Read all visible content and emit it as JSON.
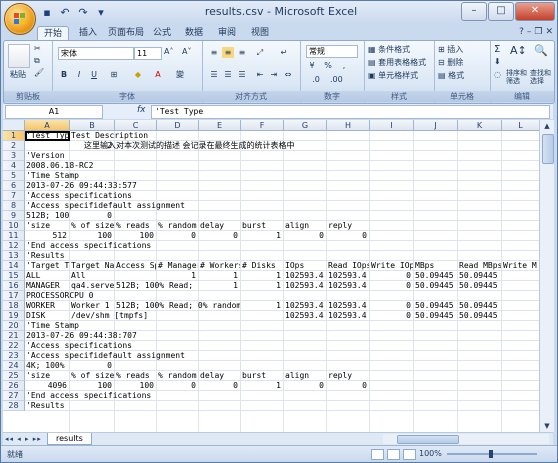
{
  "window": {
    "title": "results.csv - Microsoft Excel"
  },
  "qat_icons": [
    "save-icon",
    "undo-icon",
    "redo-icon",
    "dropdown-icon"
  ],
  "tabs": [
    "开始",
    "插入",
    "页面布局",
    "公式",
    "数据",
    "审阅",
    "视图"
  ],
  "ribbon": {
    "clipboard": {
      "paste": "粘贴",
      "label": "剪贴板"
    },
    "font": {
      "name": "宋体",
      "size": "11",
      "bold": "B",
      "italic": "I",
      "underline": "U",
      "label": "字体"
    },
    "alignment": {
      "label": "对齐方式"
    },
    "number": {
      "format": "常规",
      "percent": "%",
      "comma": ",",
      "label": "数字"
    },
    "styles": {
      "conditional": "条件格式",
      "table": "套用表格格式",
      "cell": "单元格样式",
      "label": "样式"
    },
    "cells": {
      "insert": "插入",
      "delete": "删除",
      "format": "格式",
      "label": "单元格"
    },
    "editing": {
      "sum": "Σ",
      "sort": "排序和筛选",
      "find": "查找和选择",
      "label": "编辑"
    }
  },
  "formula_bar": {
    "name_box": "A1",
    "fx": "fx",
    "content": "'Test Type"
  },
  "columns": [
    "A",
    "B",
    "C",
    "D",
    "E",
    "F",
    "G",
    "H",
    "I",
    "J",
    "K",
    "L"
  ],
  "rows": [
    {
      "n": "1",
      "cells": [
        [
          "A",
          "'Test Type"
        ],
        [
          "B",
          "Test Description"
        ]
      ]
    },
    {
      "n": "2",
      "cells": [
        [
          "Bn",
          "2"
        ],
        [
          "B2",
          "这里输入对本次测试的描述 会记录在最终生成的统计表格中"
        ]
      ]
    },
    {
      "n": "3",
      "cells": [
        [
          "A",
          "'Version"
        ]
      ]
    },
    {
      "n": "4",
      "cells": [
        [
          "A",
          "2008.06.18-RC2"
        ]
      ]
    },
    {
      "n": "5",
      "cells": [
        [
          "A",
          "'Time Stamp"
        ]
      ]
    },
    {
      "n": "6",
      "cells": [
        [
          "A",
          "2013-07-26 09:44:33:577"
        ]
      ]
    },
    {
      "n": "7",
      "cells": [
        [
          "A",
          "'Access specifications"
        ]
      ]
    },
    {
      "n": "8",
      "cells": [
        [
          "A",
          "'Access specifidefault assignment"
        ]
      ]
    },
    {
      "n": "9",
      "cells": [
        [
          "A",
          "512B; 100"
        ],
        [
          "Bn",
          "0"
        ]
      ]
    },
    {
      "n": "10",
      "cells": [
        [
          "A",
          "'size"
        ],
        [
          "B",
          "% of size"
        ],
        [
          "C",
          "% reads"
        ],
        [
          "D",
          "% random"
        ],
        [
          "E",
          "delay"
        ],
        [
          "F",
          "burst"
        ],
        [
          "G",
          "align"
        ],
        [
          "H",
          "reply"
        ]
      ]
    },
    {
      "n": "11",
      "cells": [
        [
          "An",
          "512"
        ],
        [
          "Bn",
          "100"
        ],
        [
          "Cn",
          "100"
        ],
        [
          "Dn",
          "0"
        ],
        [
          "En",
          "0"
        ],
        [
          "Fn",
          "1"
        ],
        [
          "Gn",
          "0"
        ],
        [
          "Hn",
          "0"
        ]
      ]
    },
    {
      "n": "12",
      "cells": [
        [
          "A",
          "'End access specifications"
        ]
      ]
    },
    {
      "n": "13",
      "cells": [
        [
          "A",
          "'Results"
        ]
      ]
    },
    {
      "n": "14",
      "cells": [
        [
          "A",
          "'Target Type"
        ],
        [
          "B",
          "Target Name"
        ],
        [
          "C",
          "Access Sp"
        ],
        [
          "D",
          "# Managers"
        ],
        [
          "E",
          "# Workers"
        ],
        [
          "F",
          "# Disks"
        ],
        [
          "G",
          "IOps"
        ],
        [
          "H",
          "Read IOps"
        ],
        [
          "I",
          "Write IOps"
        ],
        [
          "J",
          "MBps"
        ],
        [
          "K",
          "Read MBps"
        ],
        [
          "L",
          "Write M"
        ]
      ]
    },
    {
      "n": "15",
      "cells": [
        [
          "A",
          "ALL"
        ],
        [
          "B",
          "All"
        ],
        [
          "Dn",
          "1"
        ],
        [
          "En",
          "1"
        ],
        [
          "Fn",
          "1"
        ],
        [
          "G",
          "102593.4"
        ],
        [
          "H",
          "102593.4"
        ],
        [
          "In",
          "0"
        ],
        [
          "J",
          "50.09445"
        ],
        [
          "K",
          "50.09445"
        ]
      ]
    },
    {
      "n": "16",
      "cells": [
        [
          "A",
          "MANAGER"
        ],
        [
          "B",
          "qa4.serve"
        ],
        [
          "C",
          "512B; 100% Read; 0"
        ],
        [
          "En",
          "1"
        ],
        [
          "Fn",
          "1"
        ],
        [
          "G",
          "102593.4"
        ],
        [
          "H",
          "102593.4"
        ],
        [
          "In",
          "0"
        ],
        [
          "J",
          "50.09445"
        ],
        [
          "K",
          "50.09445"
        ]
      ]
    },
    {
      "n": "17",
      "cells": [
        [
          "A",
          "PROCESSORCPU 0"
        ]
      ]
    },
    {
      "n": "18",
      "cells": [
        [
          "A",
          "WORKER"
        ],
        [
          "B",
          "Worker 1"
        ],
        [
          "C",
          "512B; 100% Read; 0% random"
        ],
        [
          "Fn",
          "1"
        ],
        [
          "G",
          "102593.4"
        ],
        [
          "H",
          "102593.4"
        ],
        [
          "In",
          "0"
        ],
        [
          "J",
          "50.09445"
        ],
        [
          "K",
          "50.09445"
        ]
      ]
    },
    {
      "n": "19",
      "cells": [
        [
          "A",
          "DISK"
        ],
        [
          "B",
          "/dev/shm [tmpfs]"
        ],
        [
          "G",
          "102593.4"
        ],
        [
          "H",
          "102593.4"
        ],
        [
          "In",
          "0"
        ],
        [
          "J",
          "50.09445"
        ],
        [
          "K",
          "50.09445"
        ]
      ]
    },
    {
      "n": "20",
      "cells": [
        [
          "A",
          "'Time Stamp"
        ]
      ]
    },
    {
      "n": "21",
      "cells": [
        [
          "A",
          "2013-07-26 09:44:38:707"
        ]
      ]
    },
    {
      "n": "22",
      "cells": [
        [
          "A",
          "'Access specifications"
        ]
      ]
    },
    {
      "n": "23",
      "cells": [
        [
          "A",
          "'Access specifidefault assignment"
        ]
      ]
    },
    {
      "n": "24",
      "cells": [
        [
          "A",
          "4K; 100%"
        ],
        [
          "Bn",
          "0"
        ]
      ]
    },
    {
      "n": "25",
      "cells": [
        [
          "A",
          "'size"
        ],
        [
          "B",
          "% of size"
        ],
        [
          "C",
          "% reads"
        ],
        [
          "D",
          "% random"
        ],
        [
          "E",
          "delay"
        ],
        [
          "F",
          "burst"
        ],
        [
          "G",
          "align"
        ],
        [
          "H",
          "reply"
        ]
      ]
    },
    {
      "n": "26",
      "cells": [
        [
          "An",
          "4096"
        ],
        [
          "Bn",
          "100"
        ],
        [
          "Cn",
          "100"
        ],
        [
          "Dn",
          "0"
        ],
        [
          "En",
          "0"
        ],
        [
          "Fn",
          "1"
        ],
        [
          "Gn",
          "0"
        ],
        [
          "Hn",
          "0"
        ]
      ]
    },
    {
      "n": "27",
      "cells": [
        [
          "A",
          "'End access specifications"
        ]
      ]
    },
    {
      "n": "28",
      "cells": [
        [
          "A",
          "'Results"
        ]
      ]
    }
  ],
  "sheet": {
    "tab": "results",
    "nav": "◂◂ ◂ ▸ ▸▸"
  },
  "status": {
    "ready": "就绪",
    "zoom": "100%"
  }
}
